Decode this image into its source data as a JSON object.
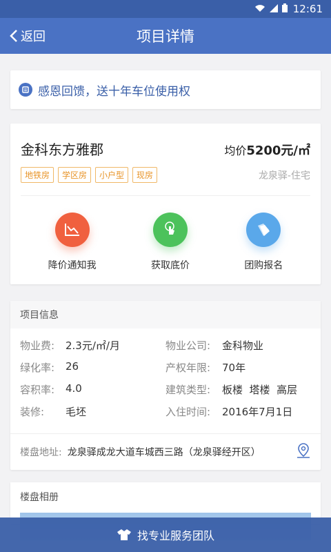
{
  "status_bar": {
    "time": "12:61"
  },
  "nav": {
    "back_label": "返回",
    "title": "项目详情"
  },
  "promo": {
    "text": "感恩回馈，送十年车位使用权"
  },
  "project": {
    "name": "金科东方雅郡",
    "price_prefix": "均价",
    "price_value": "5200元/㎡",
    "tags": [
      "地铁房",
      "学区房",
      "小户型",
      "现房"
    ],
    "district": "龙泉驿-住宅"
  },
  "actions": [
    {
      "label": "降价通知我",
      "icon": "price-chart-icon"
    },
    {
      "label": "获取底价",
      "icon": "tap-icon"
    },
    {
      "label": "团购报名",
      "icon": "tags-icon"
    }
  ],
  "info": {
    "title": "项目信息",
    "rows": [
      {
        "k1": "物业费:",
        "v1": "2.3元/㎡/月",
        "k2": "物业公司:",
        "v2": "金科物业"
      },
      {
        "k1": "绿化率:",
        "v1": "26",
        "k2": "产权年限:",
        "v2": "70年"
      },
      {
        "k1": "容积率:",
        "v1": "4.0",
        "k2": "建筑类型:",
        "v2": "板楼  塔楼  高层"
      },
      {
        "k1": "装修:",
        "v1": "毛坯",
        "k2": "入住时间:",
        "v2": "2016年7月1日"
      }
    ],
    "address_label": "楼盘地址:",
    "address_value": "龙泉驿成龙大道车城西三路（龙泉驿经开区）"
  },
  "album": {
    "title": "楼盘相册"
  },
  "bottom_bar": {
    "label": "找专业服务团队"
  },
  "colors": {
    "primary": "#4a72c4",
    "status": "#3a5fa8",
    "tag": "#e8952a",
    "red": "#f0603f",
    "green": "#4cc25b",
    "blue": "#5aa8ea"
  }
}
